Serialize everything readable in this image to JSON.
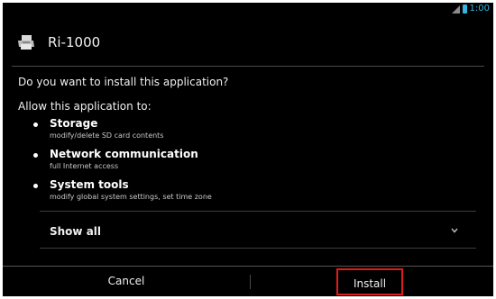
{
  "status_bar": {
    "time": "1:00",
    "icons": [
      "signal-icon",
      "battery-icon"
    ],
    "accent_color": "#33b5e5"
  },
  "app": {
    "name": "Ri-1000",
    "icon": "printer-icon"
  },
  "dialog": {
    "question": "Do you want to install this application?",
    "allow_label": "Allow this application to:",
    "permissions": [
      {
        "title": "Storage",
        "description": "modify/delete SD card contents"
      },
      {
        "title": "Network communication",
        "description": "full Internet access"
      },
      {
        "title": "System tools",
        "description": "modify global system settings, set time zone"
      }
    ],
    "show_all_label": "Show all"
  },
  "buttons": {
    "cancel_label": "Cancel",
    "install_label": "Install",
    "highlight_color": "#e01b1b"
  }
}
